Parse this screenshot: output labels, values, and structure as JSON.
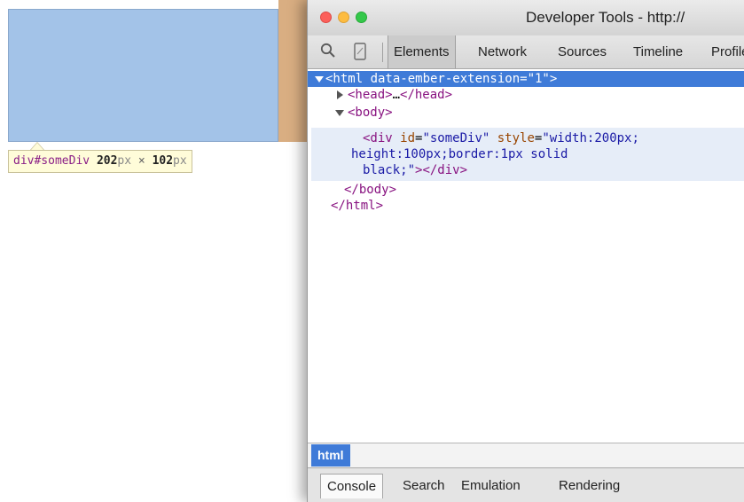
{
  "inspected_page": {
    "tooltip": {
      "tag": "div",
      "id": "#someDiv",
      "width": "202",
      "height": "102",
      "unit": "px",
      "separator": "×"
    }
  },
  "devtools": {
    "window_title": "Developer Tools - http://",
    "toolbar": {
      "search_icon": "search-icon",
      "device_icon": "device-mode-icon",
      "tabs": [
        "Elements",
        "Network",
        "Sources",
        "Timeline",
        "Profiles"
      ],
      "active_tab": "Elements"
    },
    "dom": {
      "html_open": "<html data-ember-extension=\"1\">",
      "head_open": "<head>",
      "head_ellipsis": "…",
      "head_close": "</head>",
      "body_open": "<body>",
      "div_tag_open": "<div",
      "div_attr_id": "id",
      "div_attr_id_value": "\"someDiv\"",
      "div_attr_style": "style",
      "div_style_value_1": "\"width:200px;",
      "div_style_value_2": "height:100px;border:1px solid",
      "div_style_value_3": "black;\"",
      "div_tag_close": "></div>",
      "body_close": "</body>",
      "html_close": "</html>"
    },
    "breadcrumb": [
      "html"
    ],
    "drawer_tabs": [
      "Console",
      "Search",
      "Emulation",
      "Rendering"
    ],
    "active_drawer_tab": "Console"
  },
  "colors": {
    "selection": "#3f7bd8",
    "highlight_overlay": "#a3c3e8",
    "tag": "#881280",
    "attribute": "#994500",
    "value": "#1a1aa6"
  }
}
